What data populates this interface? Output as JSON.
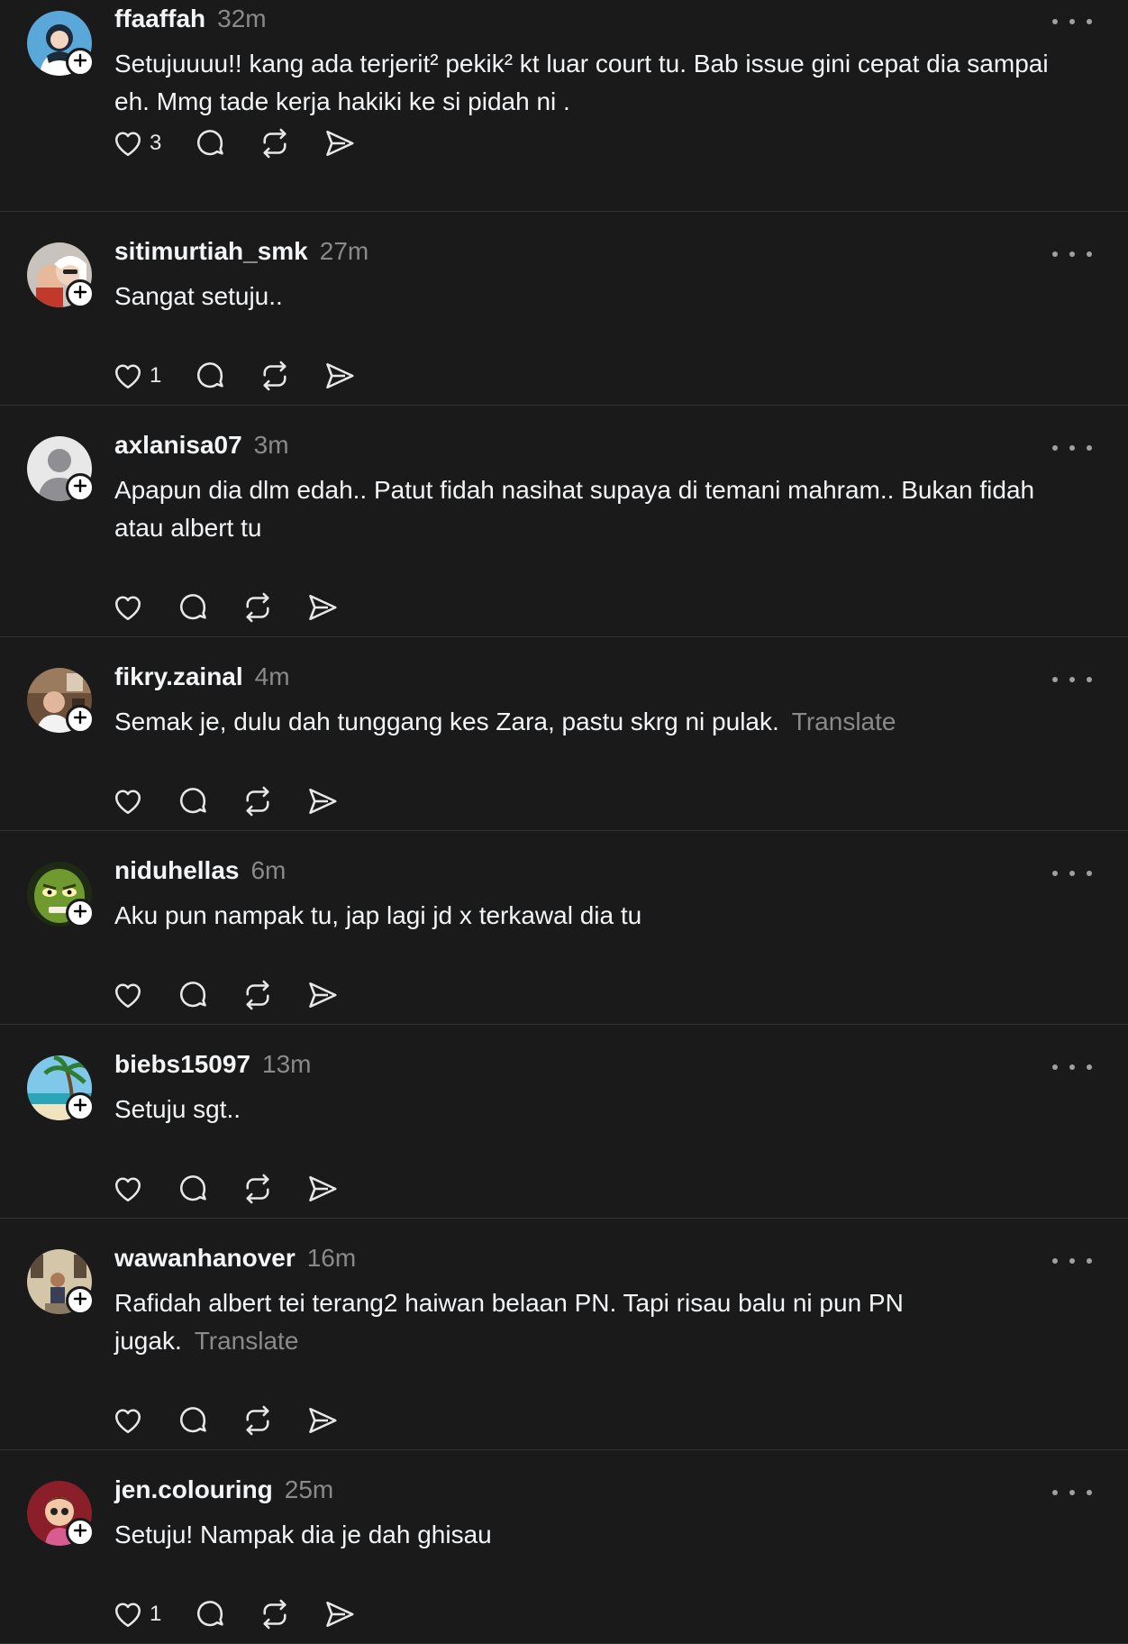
{
  "theme": {
    "background": "#1a1a1b",
    "text": "#f3f5f7",
    "muted": "#8a8a8a",
    "divider": "#333336"
  },
  "action_icons": [
    "heart-icon",
    "comment-icon",
    "repost-icon",
    "share-icon"
  ],
  "posts": [
    {
      "username": "ffaaffah",
      "time": "32m",
      "text": "Setujuuuu!! kang ada terjerit² pekik² kt luar court tu. Bab issue gini cepat dia sampai eh. Mmg tade kerja hakiki ke si pidah ni .",
      "likes": "3",
      "translate": ""
    },
    {
      "username": "sitimurtiah_smk",
      "time": "27m",
      "text": "Sangat setuju..",
      "likes": "1",
      "translate": ""
    },
    {
      "username": "axlanisa07",
      "time": "3m",
      "text": "Apapun dia dlm edah.. Patut fidah nasihat supaya di temani mahram.. Bukan fidah atau albert tu",
      "likes": "",
      "translate": ""
    },
    {
      "username": "fikry.zainal",
      "time": "4m",
      "text": "Semak je, dulu dah tunggang kes Zara, pastu skrg ni pulak.",
      "likes": "",
      "translate": "Translate"
    },
    {
      "username": "niduhellas",
      "time": "6m",
      "text": "Aku pun nampak tu, jap lagi jd x terkawal dia tu",
      "likes": "",
      "translate": ""
    },
    {
      "username": "biebs15097",
      "time": "13m",
      "text": "Setuju sgt..",
      "likes": "",
      "translate": ""
    },
    {
      "username": "wawanhanover",
      "time": "16m",
      "text": "Rafidah albert tei terang2 haiwan belaan PN. Tapi risau balu ni pun PN jugak.",
      "likes": "",
      "translate": "Translate"
    },
    {
      "username": "jen.colouring",
      "time": "25m",
      "text": "Setuju! Nampak dia je dah ghisau",
      "likes": "1",
      "translate": ""
    }
  ]
}
